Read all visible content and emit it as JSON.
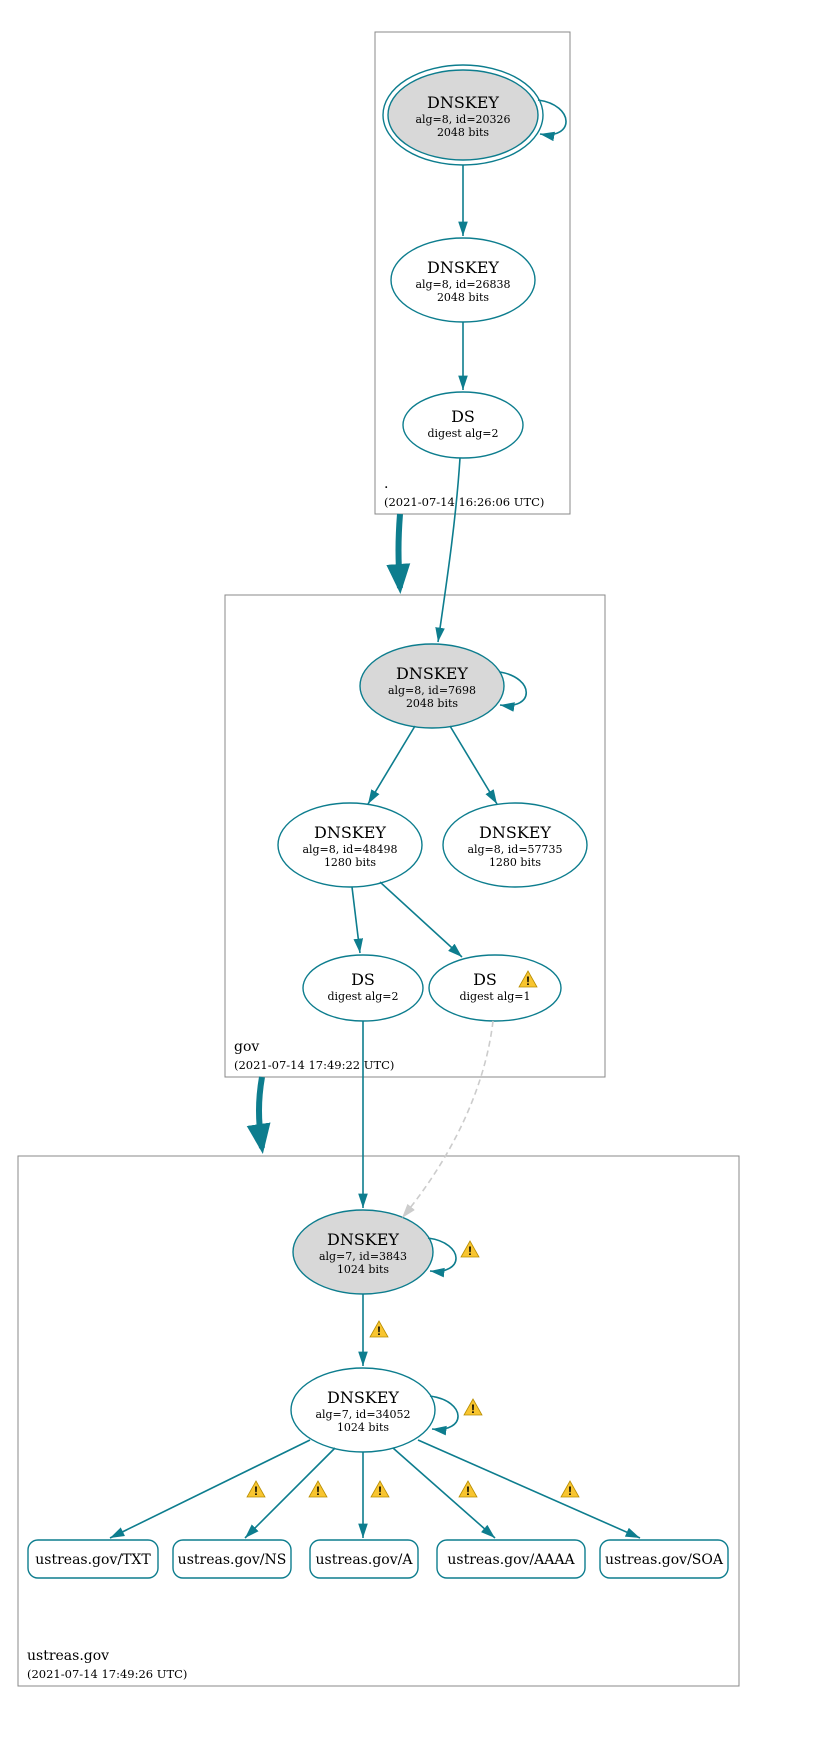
{
  "zones": {
    "root": {
      "name": ".",
      "timestamp": "(2021-07-14 16:26:06 UTC)"
    },
    "gov": {
      "name": "gov",
      "timestamp": "(2021-07-14 17:49:22 UTC)"
    },
    "ustreas": {
      "name": "ustreas.gov",
      "timestamp": "(2021-07-14 17:49:26 UTC)"
    }
  },
  "nodes": {
    "root_ksk": {
      "title": "DNSKEY",
      "line1": "alg=8, id=20326",
      "line2": "2048 bits"
    },
    "root_zsk": {
      "title": "DNSKEY",
      "line1": "alg=8, id=26838",
      "line2": "2048 bits"
    },
    "root_ds": {
      "title": "DS",
      "line1": "digest alg=2"
    },
    "gov_ksk": {
      "title": "DNSKEY",
      "line1": "alg=8, id=7698",
      "line2": "2048 bits"
    },
    "gov_zsk1": {
      "title": "DNSKEY",
      "line1": "alg=8, id=48498",
      "line2": "1280 bits"
    },
    "gov_zsk2": {
      "title": "DNSKEY",
      "line1": "alg=8, id=57735",
      "line2": "1280 bits"
    },
    "gov_ds1": {
      "title": "DS",
      "line1": "digest alg=2"
    },
    "gov_ds2": {
      "title": "DS",
      "line1": "digest alg=1"
    },
    "us_ksk": {
      "title": "DNSKEY",
      "line1": "alg=7, id=3843",
      "line2": "1024 bits"
    },
    "us_zsk": {
      "title": "DNSKEY",
      "line1": "alg=7, id=34052",
      "line2": "1024 bits"
    }
  },
  "rr": {
    "txt": "ustreas.gov/TXT",
    "ns": "ustreas.gov/NS",
    "a": "ustreas.gov/A",
    "aaaa": "ustreas.gov/AAAA",
    "soa": "ustreas.gov/SOA"
  }
}
